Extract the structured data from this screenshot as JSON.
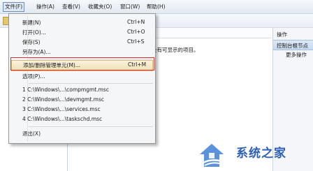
{
  "menubar": {
    "items": [
      "文件(F)",
      "操作(A)",
      "查看(V)",
      "收藏夹(O)",
      "窗口(W)",
      "帮助(H)"
    ]
  },
  "center": {
    "empty_message": "没有可显示的项目。"
  },
  "actions": {
    "title": "操作",
    "subheader": "控制台根节点",
    "more": "更多操作"
  },
  "file_menu": {
    "items": [
      {
        "label": "新建(N)",
        "shortcut": "Ctrl+N"
      },
      {
        "label": "打开(O)...",
        "shortcut": "Ctrl+O"
      },
      {
        "label": "保存(S)",
        "shortcut": "Ctrl+S"
      },
      {
        "label": "另存为(A)...",
        "shortcut": ""
      },
      {
        "label": "添加/删除管理单元(M)...",
        "shortcut": "Ctrl+M"
      },
      {
        "label": "选项(P)...",
        "shortcut": ""
      },
      {
        "label": "1 C:\\Windows\\...\\compmgmt.msc",
        "shortcut": ""
      },
      {
        "label": "2 C:\\Windows\\...\\devmgmt.msc",
        "shortcut": ""
      },
      {
        "label": "3 C:\\Windows\\...\\services.msc",
        "shortcut": ""
      },
      {
        "label": "4 C:\\Windows\\...\\taskschd.msc",
        "shortcut": ""
      },
      {
        "label": "退出(X)",
        "shortcut": ""
      }
    ]
  },
  "watermark": {
    "text": "系统之家"
  },
  "colors": {
    "highlight_border": "#e02f2f",
    "menu_hover": "#f0dfb0",
    "watermark": "#2c5fb5"
  }
}
